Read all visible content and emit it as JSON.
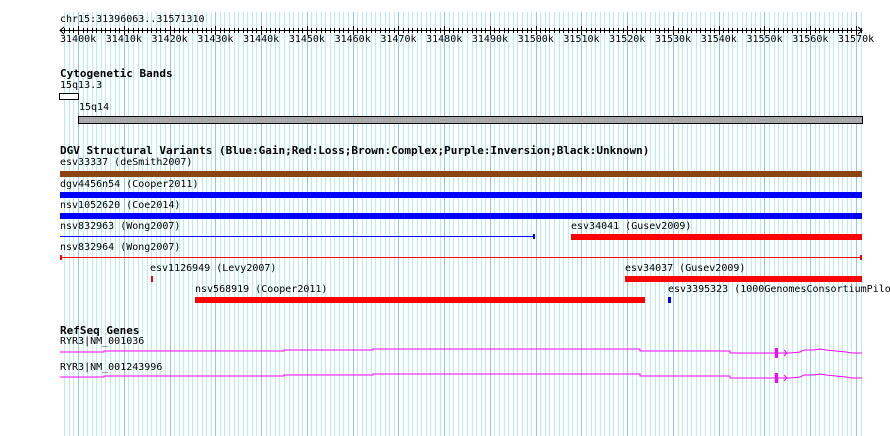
{
  "ruler": {
    "location": "chr15:31396063..31571310",
    "start": 31396063,
    "end": 31571310,
    "ticks": [
      "31400k",
      "31410k",
      "31420k",
      "31430k",
      "31440k",
      "31450k",
      "31460k",
      "31470k",
      "31480k",
      "31490k",
      "31500k",
      "31510k",
      "31520k",
      "31530k",
      "31540k",
      "31550k",
      "31560k",
      "31570k"
    ]
  },
  "cyto": {
    "title": "Cytogenetic Bands",
    "bands": [
      {
        "name": "15q13.3",
        "color": "#ffffff"
      },
      {
        "name": "15q14",
        "color": "#aaaaaa"
      }
    ]
  },
  "dgv": {
    "title": "DGV Structural Variants (Blue:Gain;Red:Loss;Brown:Complex;Purple:Inversion;Black:Unknown)",
    "colors": {
      "gain": "#0000ff",
      "loss": "#ff0000",
      "complex": "#8b4513"
    },
    "items": [
      {
        "label": "esv33337 (deSmith2007)",
        "type": "complex"
      },
      {
        "label": "dgv4456n54 (Cooper2011)",
        "type": "gain"
      },
      {
        "label": "nsv1052620 (Coe2014)",
        "type": "gain"
      },
      {
        "label": "nsv832963 (Wong2007)",
        "type": "gain"
      },
      {
        "label": "esv34041 (Gusev2009)",
        "type": "loss"
      },
      {
        "label": "nsv832964 (Wong2007)",
        "type": "loss"
      },
      {
        "label": "esv1126949 (Levy2007)",
        "type": "loss"
      },
      {
        "label": "esv34037 (Gusev2009)",
        "type": "loss"
      },
      {
        "label": "nsv568919 (Cooper2011)",
        "type": "loss"
      },
      {
        "label": "esv3395323 (1000GenomesConsortiumPilo",
        "type": "gain"
      }
    ]
  },
  "refseq": {
    "title": "RefSeq Genes",
    "color": "#ff00ff",
    "genes": [
      {
        "label": "RYR3|NM_001036"
      },
      {
        "label": "RYR3|NM_001243996"
      }
    ]
  }
}
